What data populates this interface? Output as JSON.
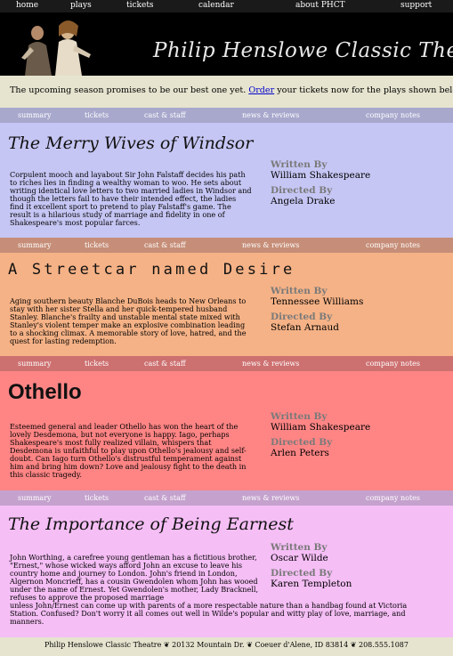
{
  "topnav": [
    "home",
    "plays",
    "tickets",
    "calendar",
    "about PHCT",
    "support"
  ],
  "banner": {
    "title": "Philip Henslowe Classic Theatre"
  },
  "intro": {
    "before": "The upcoming season promises to be our best one yet.",
    "link": "Order",
    "after": "your tickets now for the plays shown below."
  },
  "subnav": [
    "summary",
    "tickets",
    "cast & staff",
    "news & reviews",
    "company notes"
  ],
  "labels": {
    "written_by": "Written By",
    "directed_by": "Directed By"
  },
  "plays": [
    {
      "title": "The Merry Wives of Windsor",
      "description": "Corpulent mooch and layabout Sir John Falstaff decides his path to riches lies in finding a wealthy woman to woo. He sets about writing identical love letters to two married ladies in Windsor and though the letters fail to have their intended effect, the ladies find it excellent sport to pretend to play Falstaff's game. The result is a hilarious study of marriage and fidelity in one of Shakespeare's most popular farces.",
      "author": "William Shakespeare",
      "director": "Angela Drake",
      "colors": {
        "bg": "#c6c6f5",
        "nav": "#a8a8cd"
      }
    },
    {
      "title": "A Streetcar named Desire",
      "description": "Aging southern beauty Blanche DuBois heads to New Orleans to stay with her sister Stella and her quick-tempered husband Stanley. Blanche's frailty and unstable mental state mixed with Stanley's violent temper make an explosive combination leading to a shocking climax. A memorable story of love, hatred, and the quest for lasting redemption.",
      "author": "Tennessee Williams",
      "director": "Stefan Arnaud",
      "colors": {
        "bg": "#f5b286",
        "nav": "#c68e78"
      }
    },
    {
      "title": "Othello",
      "description": "Esteemed general and leader Othello has won the heart of the lovely Desdemona, but not everyone is happy. Iago, perhaps Shakespeare's most fully realized villain, whispers that Desdemona is unfaithful to play upon Othello's jealousy and self-doubt. Can Iago turn Othello's distrustful temperament against him and bring him down? Love and jealousy fight to the death in this classic tragedy.",
      "author": "William Shakespeare",
      "director": "Arlen Peters",
      "colors": {
        "bg": "#ff8585",
        "nav": "#cd7070"
      }
    },
    {
      "title": "The Importance of Being Earnest",
      "description": "John Worthing, a carefree young gentleman has a fictitious brother, \"Ernest,\" whose wicked ways afford John an excuse to leave his country home and journey to London. John's friend in London, Algernon Moncrieff, has a cousin Gwendolen whom John has wooed under the name of Ernest. Yet Gwendolen's mother, Lady Bracknell, refuses to approve the proposed marriage unless John/Ernest can come up with parents of a more respectable nature than a handbag found at Victoria Station. Confused? Don't worry it all comes out well in Wilde's popular and witty play of love, marriage, and manners.",
      "author": "Oscar Wilde",
      "director": "Karen Templeton",
      "colors": {
        "bg": "#f5bef5",
        "nav": "#c4a2cd"
      }
    }
  ],
  "footer": "Philip Henslowe Classic Theatre ❦ 20132 Mountain Dr. ❦ Coeuer d'Alene, ID 83814 ❦ 208.555.1087"
}
